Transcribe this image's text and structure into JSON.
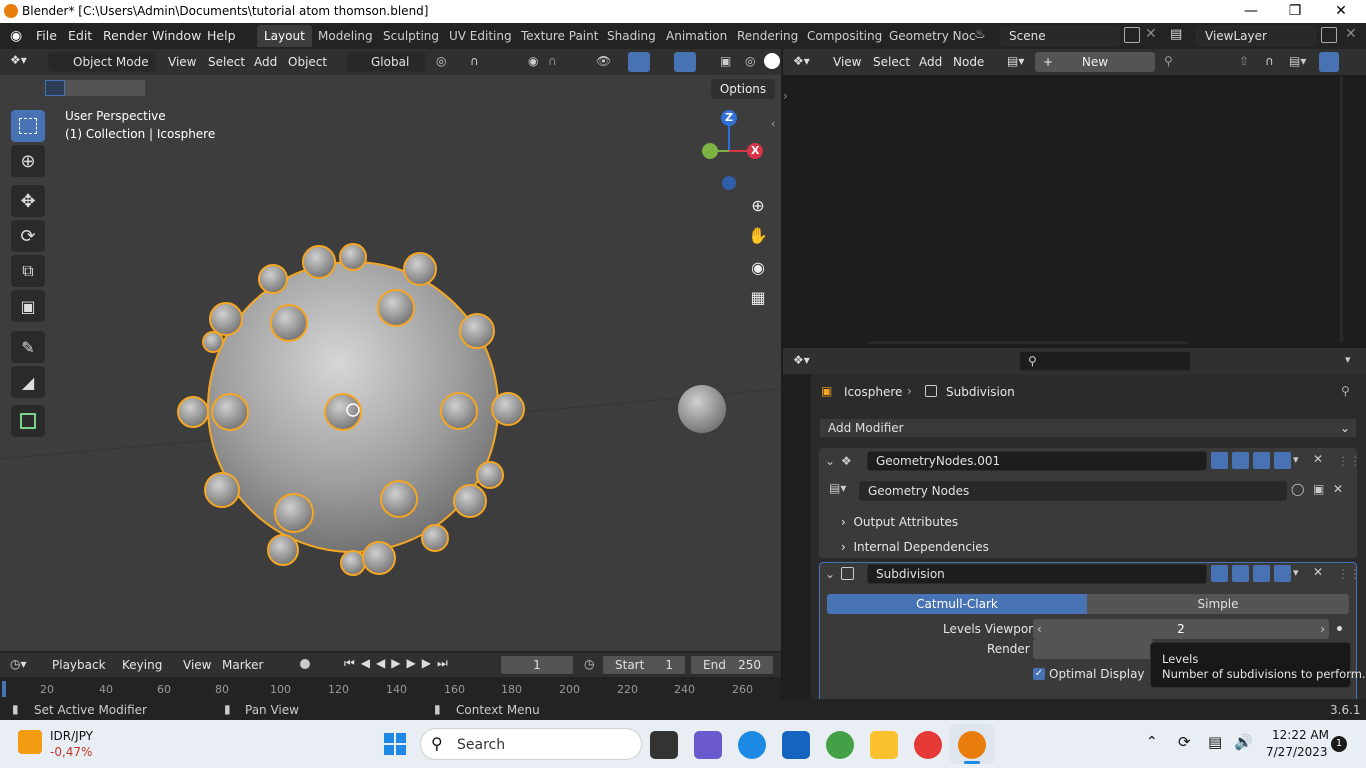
{
  "window": {
    "title": "Blender* [C:\\Users\\Admin\\Documents\\tutorial atom thomson.blend]"
  },
  "menubar": {
    "items": [
      "File",
      "Edit",
      "Render",
      "Window",
      "Help"
    ]
  },
  "workspaces": [
    "Layout",
    "Modeling",
    "Sculpting",
    "UV Editing",
    "Texture Paint",
    "Shading",
    "Animation",
    "Rendering",
    "Compositing",
    "Geometry Noc"
  ],
  "scene": {
    "label": "Scene",
    "view_layer": "ViewLayer"
  },
  "viewport_header": {
    "mode": "Object Mode",
    "menus": [
      "View",
      "Select",
      "Add",
      "Object"
    ],
    "transform": "Global",
    "options": "Options"
  },
  "viewport": {
    "perspective": "User Perspective",
    "collection": "(1) Collection | Icosphere",
    "gizmo": {
      "z": "Z",
      "x": "X"
    }
  },
  "node_header": {
    "menus": [
      "View",
      "Select",
      "Add",
      "Node"
    ],
    "new_label": "New"
  },
  "properties": {
    "breadcrumb": {
      "object": "Icosphere",
      "modifier": "Subdivision"
    },
    "add_modifier": "Add Modifier",
    "geo_modifier": {
      "name": "GeometryNodes.001",
      "node_group": "Geometry Nodes",
      "panels": [
        "Output Attributes",
        "Internal Dependencies"
      ]
    },
    "subdiv_modifier": {
      "name": "Subdivision",
      "modes": [
        "Catmull-Clark",
        "Simple"
      ],
      "levels_label": "Levels Viewport",
      "levels_value": "2",
      "render_label": "Render",
      "optimal_display": "Optimal Display"
    },
    "tooltip": {
      "title": "Levels",
      "body": "Number of subdivisions to perform."
    }
  },
  "timeline": {
    "menus": [
      "Playback",
      "Keying",
      "View",
      "Marker"
    ],
    "current_frame": "1",
    "start_label": "Start",
    "start": "1",
    "end_label": "End",
    "end": "250",
    "ticks": [
      "20",
      "40",
      "60",
      "80",
      "100",
      "120",
      "140",
      "160",
      "180",
      "200",
      "220",
      "240",
      "260"
    ]
  },
  "statusbar": {
    "left": "Set Active Modifier",
    "middle": "Pan View",
    "right": "Context Menu",
    "version": "3.6.1"
  },
  "taskbar": {
    "ticker": "IDR/JPY",
    "ticker_change": "-0,47%",
    "search": "Search",
    "time": "12:22 AM",
    "date": "7/27/2023",
    "notifications": "1"
  },
  "colors": {
    "accent": "#4772b3",
    "selection": "#f5a623",
    "bg": "#1d1d1d",
    "panel": "#303030"
  }
}
